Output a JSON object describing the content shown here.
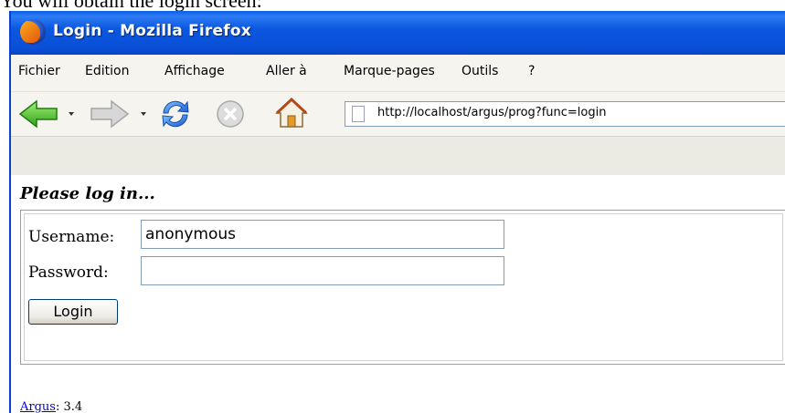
{
  "caption": "You will obtain the login screen:",
  "window": {
    "title": "Login - Mozilla Firefox"
  },
  "menu": {
    "items": [
      {
        "label": "Fichier"
      },
      {
        "label": "Edition"
      },
      {
        "label": "Affichage"
      },
      {
        "label": "Aller à"
      },
      {
        "label": "Marque-pages"
      },
      {
        "label": "Outils"
      },
      {
        "label": "?"
      }
    ]
  },
  "toolbar": {
    "icons": [
      "back-icon",
      "forward-icon",
      "reload-icon",
      "stop-icon",
      "home-icon"
    ],
    "url": "http://localhost/argus/prog?func=login"
  },
  "page": {
    "heading": "Please log in...",
    "username_label": "Username:",
    "username_value": "anonymous",
    "password_label": "Password:",
    "password_value": "",
    "login_button": "Login",
    "footer_link": "Argus",
    "footer_version": ": 3.4"
  }
}
